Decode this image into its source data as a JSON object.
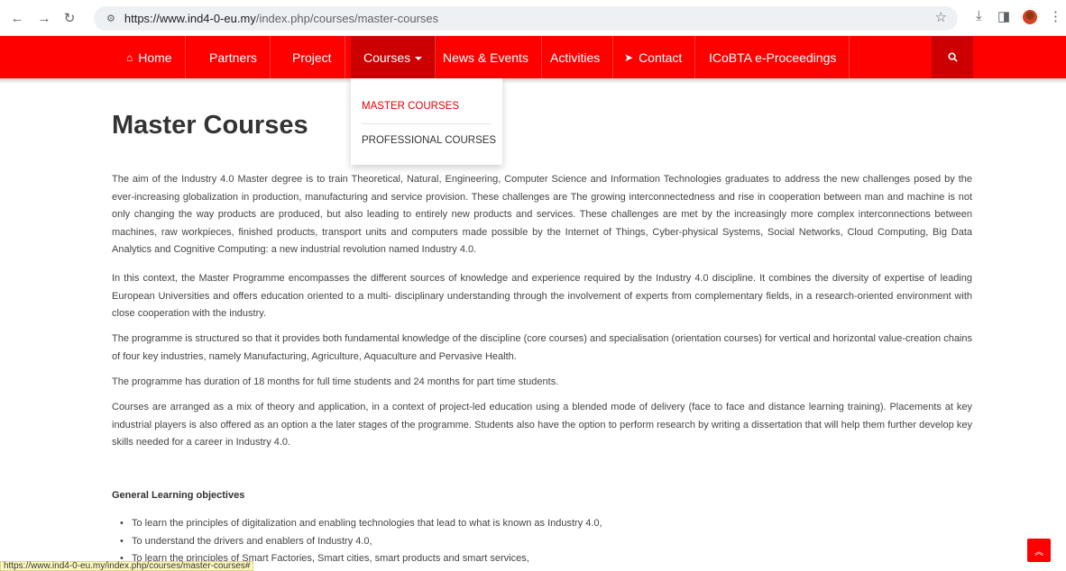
{
  "browser": {
    "url_domain": "https://www.ind4-0-eu.my",
    "url_path": "/index.php/courses/master-courses",
    "status_url": "https://www.ind4-0-eu.my/index.php/courses/master-courses#"
  },
  "nav": {
    "items": [
      {
        "label": "Home",
        "icon": "home-icon"
      },
      {
        "label": "Partners"
      },
      {
        "label": "Project"
      },
      {
        "label": "Courses"
      },
      {
        "label": "News & Events"
      },
      {
        "label": "Activities"
      },
      {
        "label": "Contact",
        "icon": "paper-plane-icon"
      },
      {
        "label": "ICoBTA e-Proceedings"
      }
    ],
    "dropdown": [
      "MASTER COURSES",
      "PROFESSIONAL COURSES"
    ]
  },
  "page": {
    "title": "Master Courses",
    "paragraphs": [
      "The aim of the Industry 4.0 Master degree is to train Theoretical, Natural, Engineering, Computer Science and Information Technologies graduates to address the new challenges posed by the ever-increasing globalization in production, manufacturing and service provision. These challenges are The growing interconnectedness and rise in cooperation between man and machine is not only changing the way products are produced, but also leading to entirely new products and services. These challenges are met by the increasingly more complex interconnections between machines, raw workpieces, finished products, transport units and computers made possible by the Internet of Things, Cyber-physical Systems, Social Networks, Cloud Computing, Big Data Analytics and Cognitive Computing: a new industrial revolution named Industry 4.0.",
      "In this context, the Master Programme encompasses the different sources of knowledge and experience required by the Industry 4.0 discipline. It combines the diversity of expertise of leading European Universities and offers education oriented to a multi- disciplinary understanding through the involvement of experts from complementary fields, in a research-oriented environment with close cooperation with the industry.",
      "The programme is structured so that it provides both fundamental knowledge of the discipline (core courses) and specialisation (orientation courses) for vertical and horizontal value-creation chains of four key industries, namely Manufacturing, Agriculture, Aquaculture and Pervasive Health.",
      "The programme has duration of 18 months for full time students and 24 months for part time students.",
      "Courses are arranged as a mix of theory and application, in a context of project-led education using a blended mode of delivery (face to face and distance learning training). Placements at key industrial players is also offered as an option a the later stages of the programme. Students also have the option to perform research by writing a dissertation that will help them further develop key skills needed for a career in Industry 4.0."
    ],
    "objectives_heading": "General Learning objectives",
    "objectives": [
      "To learn the principles of digitalization and enabling technologies that lead to what is known as Industry 4.0,",
      "To understand the drivers and enablers of Industry 4.0,",
      "To learn the principles of Smart Factories, Smart cities, smart products and smart services,"
    ]
  },
  "colors": {
    "brand_red": "#fe0000",
    "active_red": "#cc0000"
  }
}
